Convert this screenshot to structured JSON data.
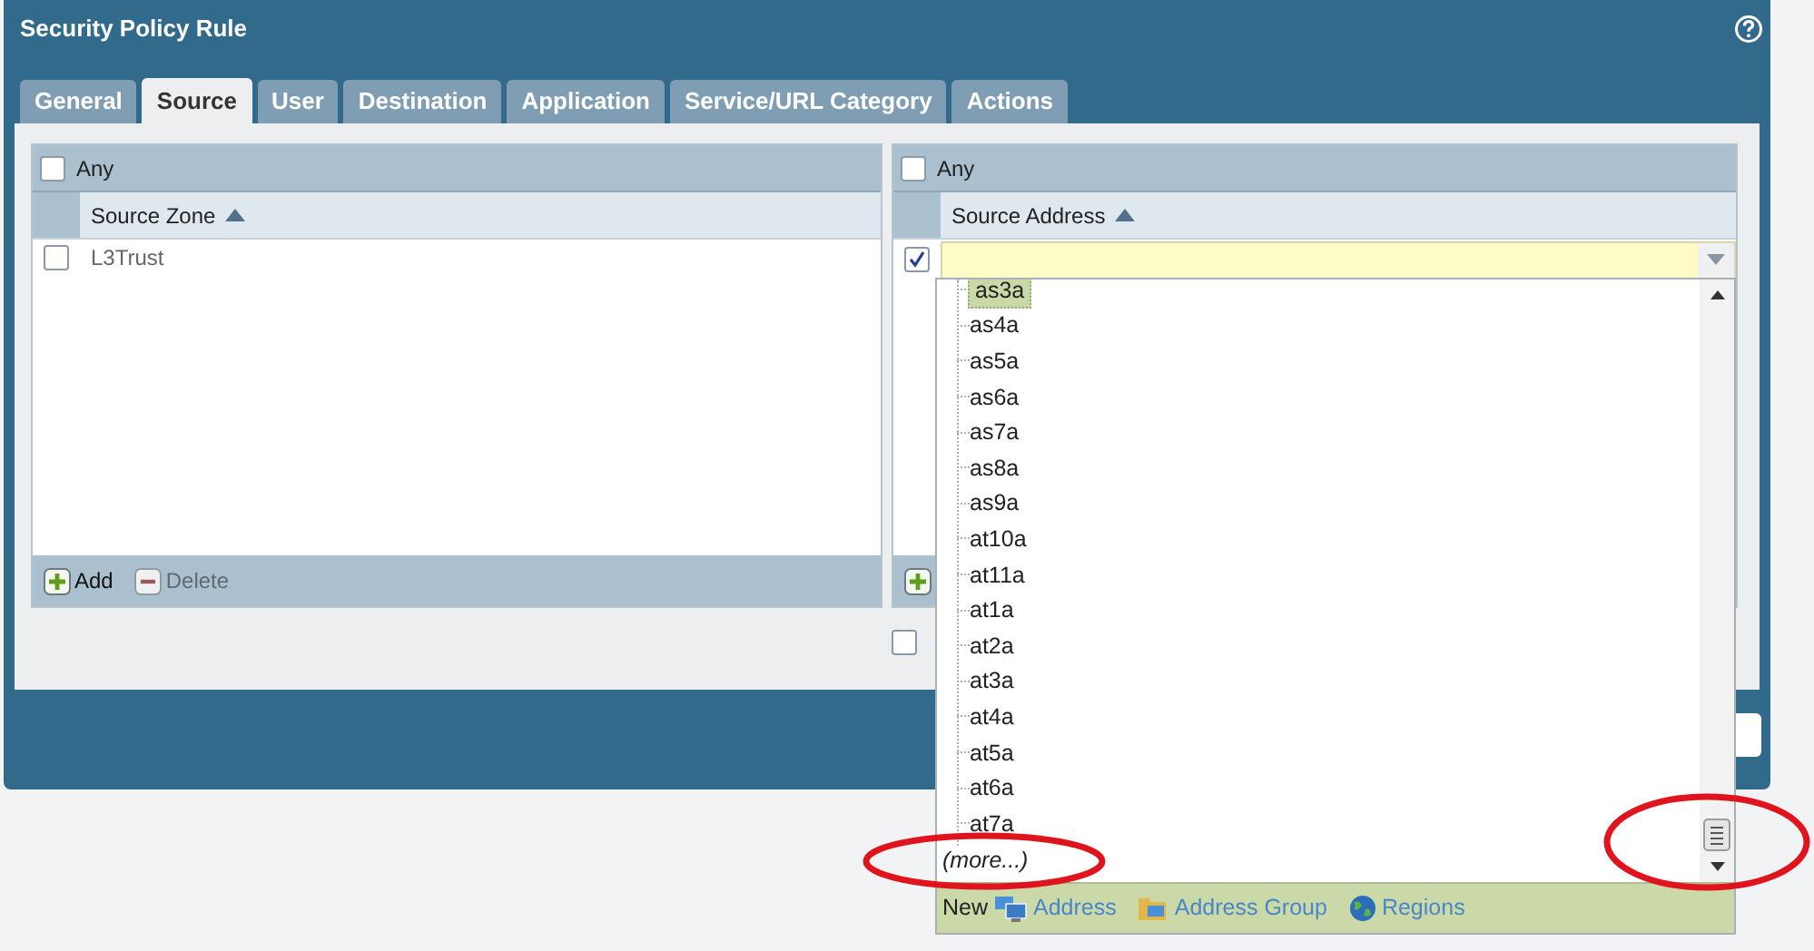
{
  "dialog": {
    "title": "Security Policy Rule"
  },
  "tabs": [
    {
      "label": "General",
      "selected": false
    },
    {
      "label": "Source",
      "selected": true
    },
    {
      "label": "User",
      "selected": false
    },
    {
      "label": "Destination",
      "selected": false
    },
    {
      "label": "Application",
      "selected": false
    },
    {
      "label": "Service/URL Category",
      "selected": false
    },
    {
      "label": "Actions",
      "selected": false
    }
  ],
  "source_zone": {
    "any": {
      "label": "Any",
      "checked": false
    },
    "column": "Source Zone",
    "rows": [
      {
        "label": "L3Trust",
        "checked": false
      }
    ],
    "footer_buttons": [
      {
        "label": "Add",
        "kind": "add",
        "disabled": false
      },
      {
        "label": "Delete",
        "kind": "delete",
        "disabled": true
      }
    ]
  },
  "source_address": {
    "any": {
      "label": "Any",
      "checked": false
    },
    "column": "Source Address",
    "rows": [
      {
        "checked": true
      }
    ]
  },
  "negate": {
    "checked": false
  },
  "dropdown": {
    "items": [
      {
        "label": "as3a",
        "selected": true
      },
      {
        "label": "as4a",
        "selected": false
      },
      {
        "label": "as5a",
        "selected": false
      },
      {
        "label": "as6a",
        "selected": false
      },
      {
        "label": "as7a",
        "selected": false
      },
      {
        "label": "as8a",
        "selected": false
      },
      {
        "label": "as9a",
        "selected": false
      },
      {
        "label": "at10a",
        "selected": false
      },
      {
        "label": "at11a",
        "selected": false
      },
      {
        "label": "at1a",
        "selected": false
      },
      {
        "label": "at2a",
        "selected": false
      },
      {
        "label": "at3a",
        "selected": false
      },
      {
        "label": "at4a",
        "selected": false
      },
      {
        "label": "at5a",
        "selected": false
      },
      {
        "label": "at6a",
        "selected": false
      },
      {
        "label": "at7a",
        "selected": false
      }
    ],
    "more": "(more...)",
    "new_label": "New",
    "links": [
      {
        "label": "Address",
        "kind": "address"
      },
      {
        "label": "Address Group",
        "kind": "group"
      },
      {
        "label": "Regions",
        "kind": "regions"
      }
    ]
  }
}
